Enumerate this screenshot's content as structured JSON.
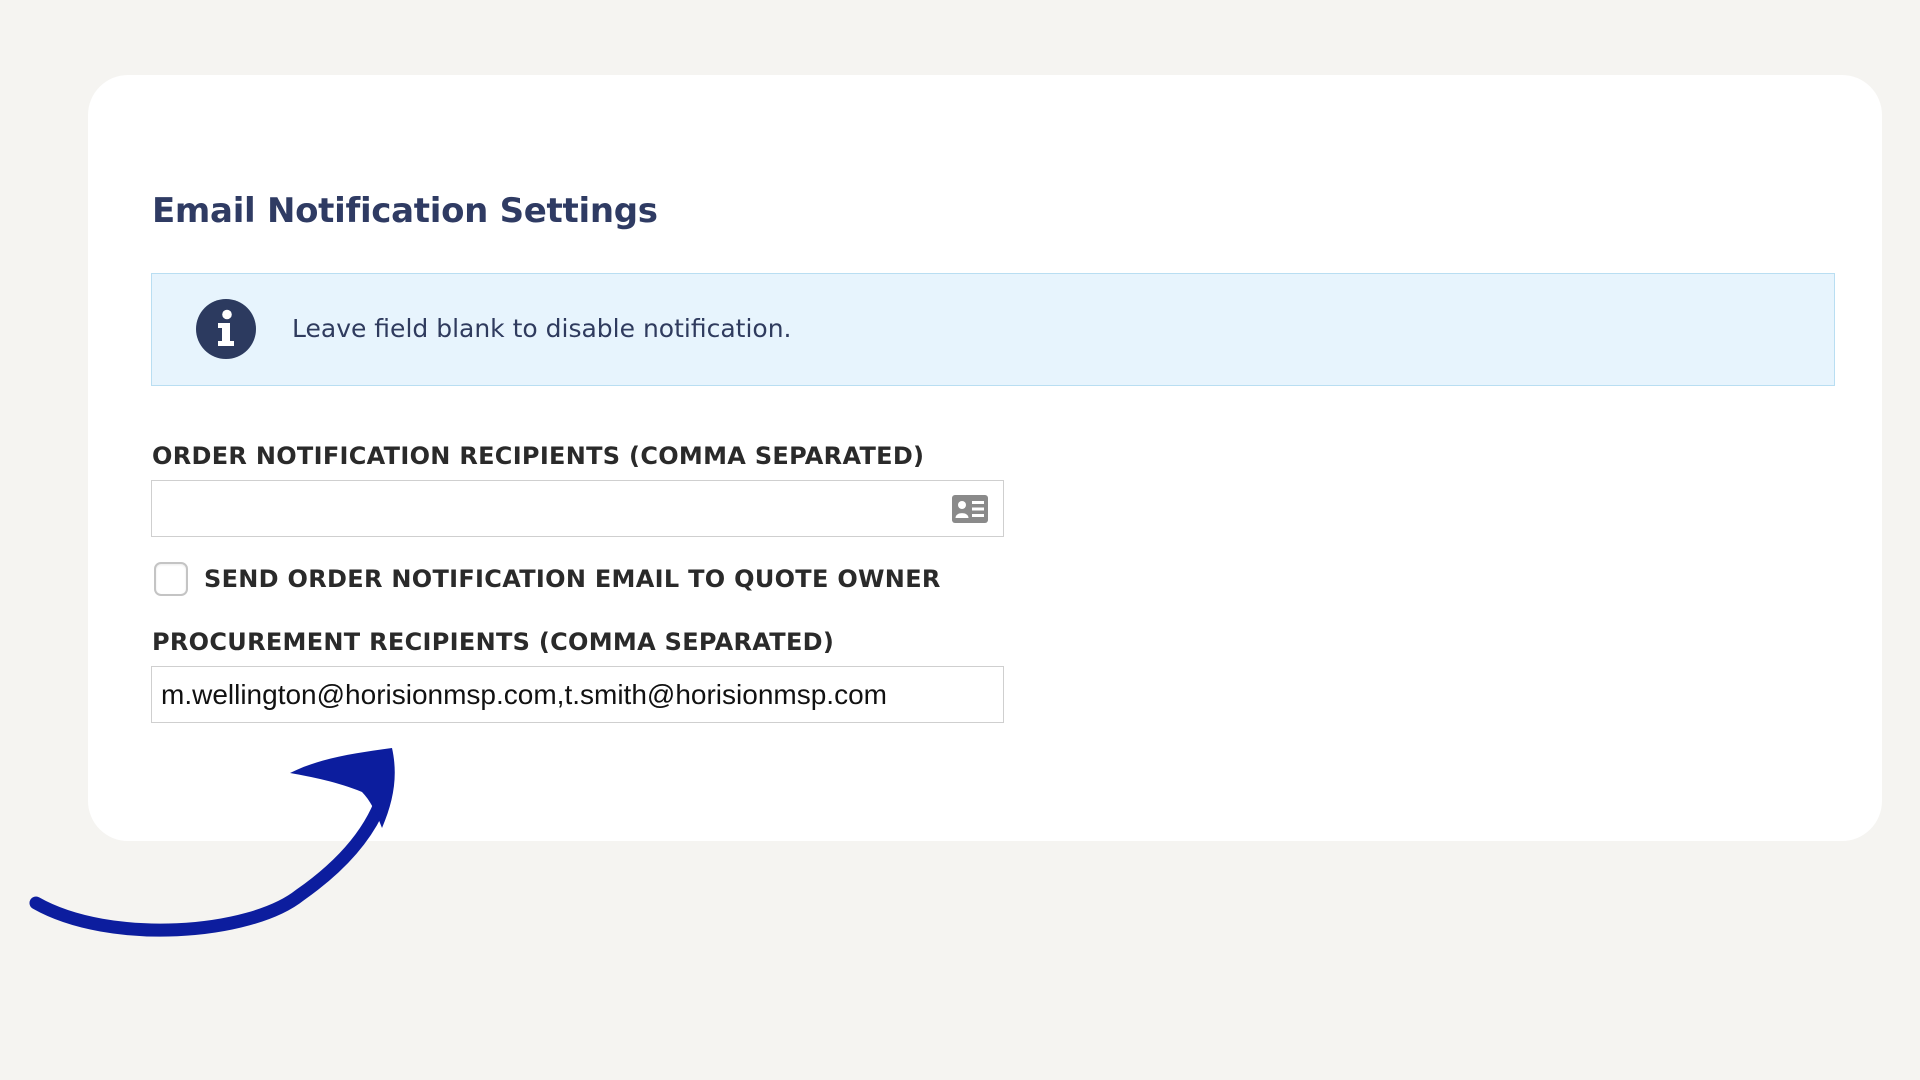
{
  "section": {
    "title": "Email Notification Settings"
  },
  "info_banner": {
    "icon": "info-circle-icon",
    "text": "Leave field blank to disable notification."
  },
  "order_recipients": {
    "label": "ORDER NOTIFICATION RECIPIENTS (COMMA SEPARATED)",
    "value": "",
    "trailing_icon": "contact-card-icon"
  },
  "quote_owner_checkbox": {
    "label": "SEND ORDER NOTIFICATION EMAIL TO QUOTE OWNER",
    "checked": false
  },
  "procurement_recipients": {
    "label": "PROCUREMENT RECIPIENTS (COMMA SEPARATED)",
    "value": "m.wellington@horisionmsp.com,t.smith@horisionmsp.com"
  },
  "colors": {
    "background": "#f5f4f1",
    "card": "#ffffff",
    "title": "#2f3b63",
    "banner_background": "#e7f4fd",
    "banner_border": "#b9def2",
    "info_icon": "#2c3a5f",
    "label": "#2a2a2a",
    "annotation_arrow": "#0c1d9e"
  },
  "annotation": {
    "icon": "curved-arrow-icon"
  }
}
